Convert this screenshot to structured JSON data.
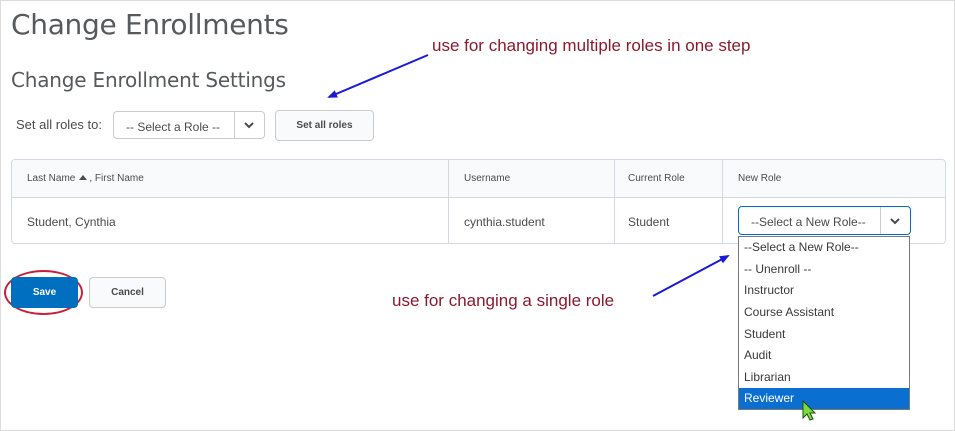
{
  "page": {
    "title": "Change Enrollments",
    "section_title": "Change Enrollment Settings"
  },
  "annotations": {
    "top": "use for changing multiple roles in one step",
    "bottom": "use for changing a single role",
    "color": "#8b1a2e",
    "arrow_color": "#1a1ad6",
    "highlight_color": "#c8203a"
  },
  "bulk": {
    "label": "Set all roles to:",
    "select_value": "-- Select a Role --",
    "button_label": "Set all roles"
  },
  "table": {
    "columns": [
      "Last Name",
      ", First Name",
      "Username",
      "Current Role",
      "New Role"
    ],
    "rows": [
      {
        "name": "Student, Cynthia",
        "username": "cynthia.student",
        "current_role": "Student",
        "new_role": "--Select a New Role--"
      }
    ]
  },
  "role_options": [
    "--Select a New Role--",
    "-- Unenroll --",
    "Instructor",
    "Course Assistant",
    "Student",
    "Audit",
    "Librarian",
    "Reviewer"
  ],
  "highlighted_option": "Reviewer",
  "actions": {
    "save_label": "Save",
    "cancel_label": "Cancel"
  },
  "colors": {
    "primary": "#006fbf",
    "selected_option": "#0a6fd0"
  }
}
